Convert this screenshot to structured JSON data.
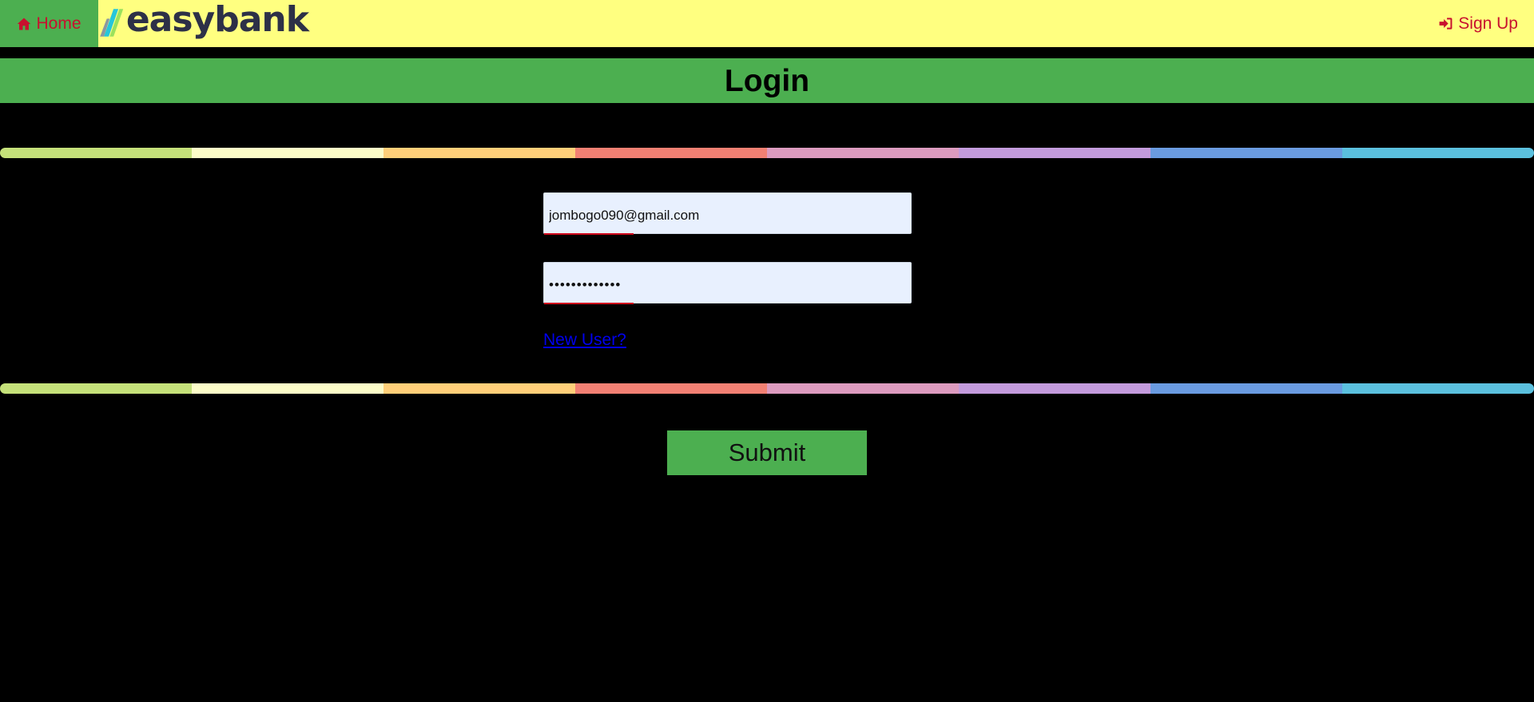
{
  "nav": {
    "home_label": "Home",
    "home_icon": "home-icon",
    "logo_text": "easybank",
    "signup_label": "Sign Up",
    "signup_icon": "sign-in-icon"
  },
  "page": {
    "title": "Login"
  },
  "form": {
    "email_value": "jombogo090@gmail.com",
    "password_value": "•••••••••••••",
    "new_user_link": "New User?",
    "submit_label": "Submit"
  },
  "colors": {
    "nav_bg": "#ffff80",
    "accent_green": "#4caf50",
    "nav_text": "#c8102e",
    "background": "#000000",
    "rainbow": [
      "#c5e17a",
      "#fdfdc9",
      "#ffcf79",
      "#f28073",
      "#dc9bbf",
      "#c39bdc",
      "#6a9be0",
      "#5bc0de"
    ]
  }
}
